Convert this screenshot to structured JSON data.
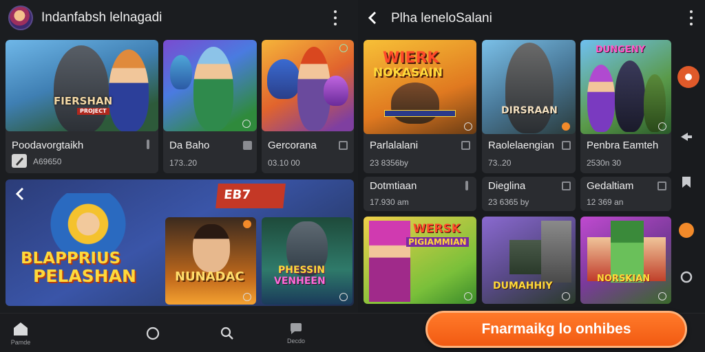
{
  "left": {
    "app_title": "Indanfabsh lelnagadi",
    "cards": [
      {
        "title": "Poodavorgtaikh",
        "meta": "A69650",
        "overlay": "FIERSHAN",
        "overlay_sub": "PROJECT"
      },
      {
        "title": "Da Baho",
        "meta": "173..20"
      },
      {
        "title": "Gercorana",
        "meta": "03.10 00"
      }
    ],
    "banner": {
      "overlay_line1": "BLAPPRIUS",
      "overlay_line2": "PELASHAN",
      "sign": "EB7"
    },
    "small_cards": [
      {
        "overlay": "NUNADAC"
      },
      {
        "overlay_line1": "PHESSIN",
        "overlay_line2": "VENHEEN"
      }
    ]
  },
  "right": {
    "title": "Plha leneloSalani",
    "row1": [
      {
        "overlay_line1": "WIERK",
        "overlay_line2": "NOKASAIN",
        "title": "Parlalalani",
        "meta": "23 8356by"
      },
      {
        "overlay": "DIRSRAAN",
        "title": "Raolelaengian",
        "meta": "73..20"
      },
      {
        "overlay": "DUNGENY",
        "title": "Penbra Eamteh",
        "meta": "2530n 30"
      }
    ],
    "row2": [
      {
        "title": "Dotmtiaan",
        "meta": "17.930 am"
      },
      {
        "title": "Dieglina",
        "meta": "23 6365 by"
      },
      {
        "title": "Gedaltiam",
        "meta": "12 369 an"
      }
    ],
    "row3": [
      {
        "overlay_line1": "WERSK",
        "overlay_line2": "PIGIAMMIAN"
      },
      {
        "overlay": "DUMAHHIY"
      },
      {
        "overlay": "NORSKIAN"
      }
    ]
  },
  "bottom_nav": {
    "home_label": "Pamde",
    "fourth_label": "Decdo"
  },
  "cta_label": "Fnarmaikg lo onhibes",
  "colors": {
    "accent": "#f25a12",
    "background": "#17191c",
    "card": "#2a2c30"
  }
}
